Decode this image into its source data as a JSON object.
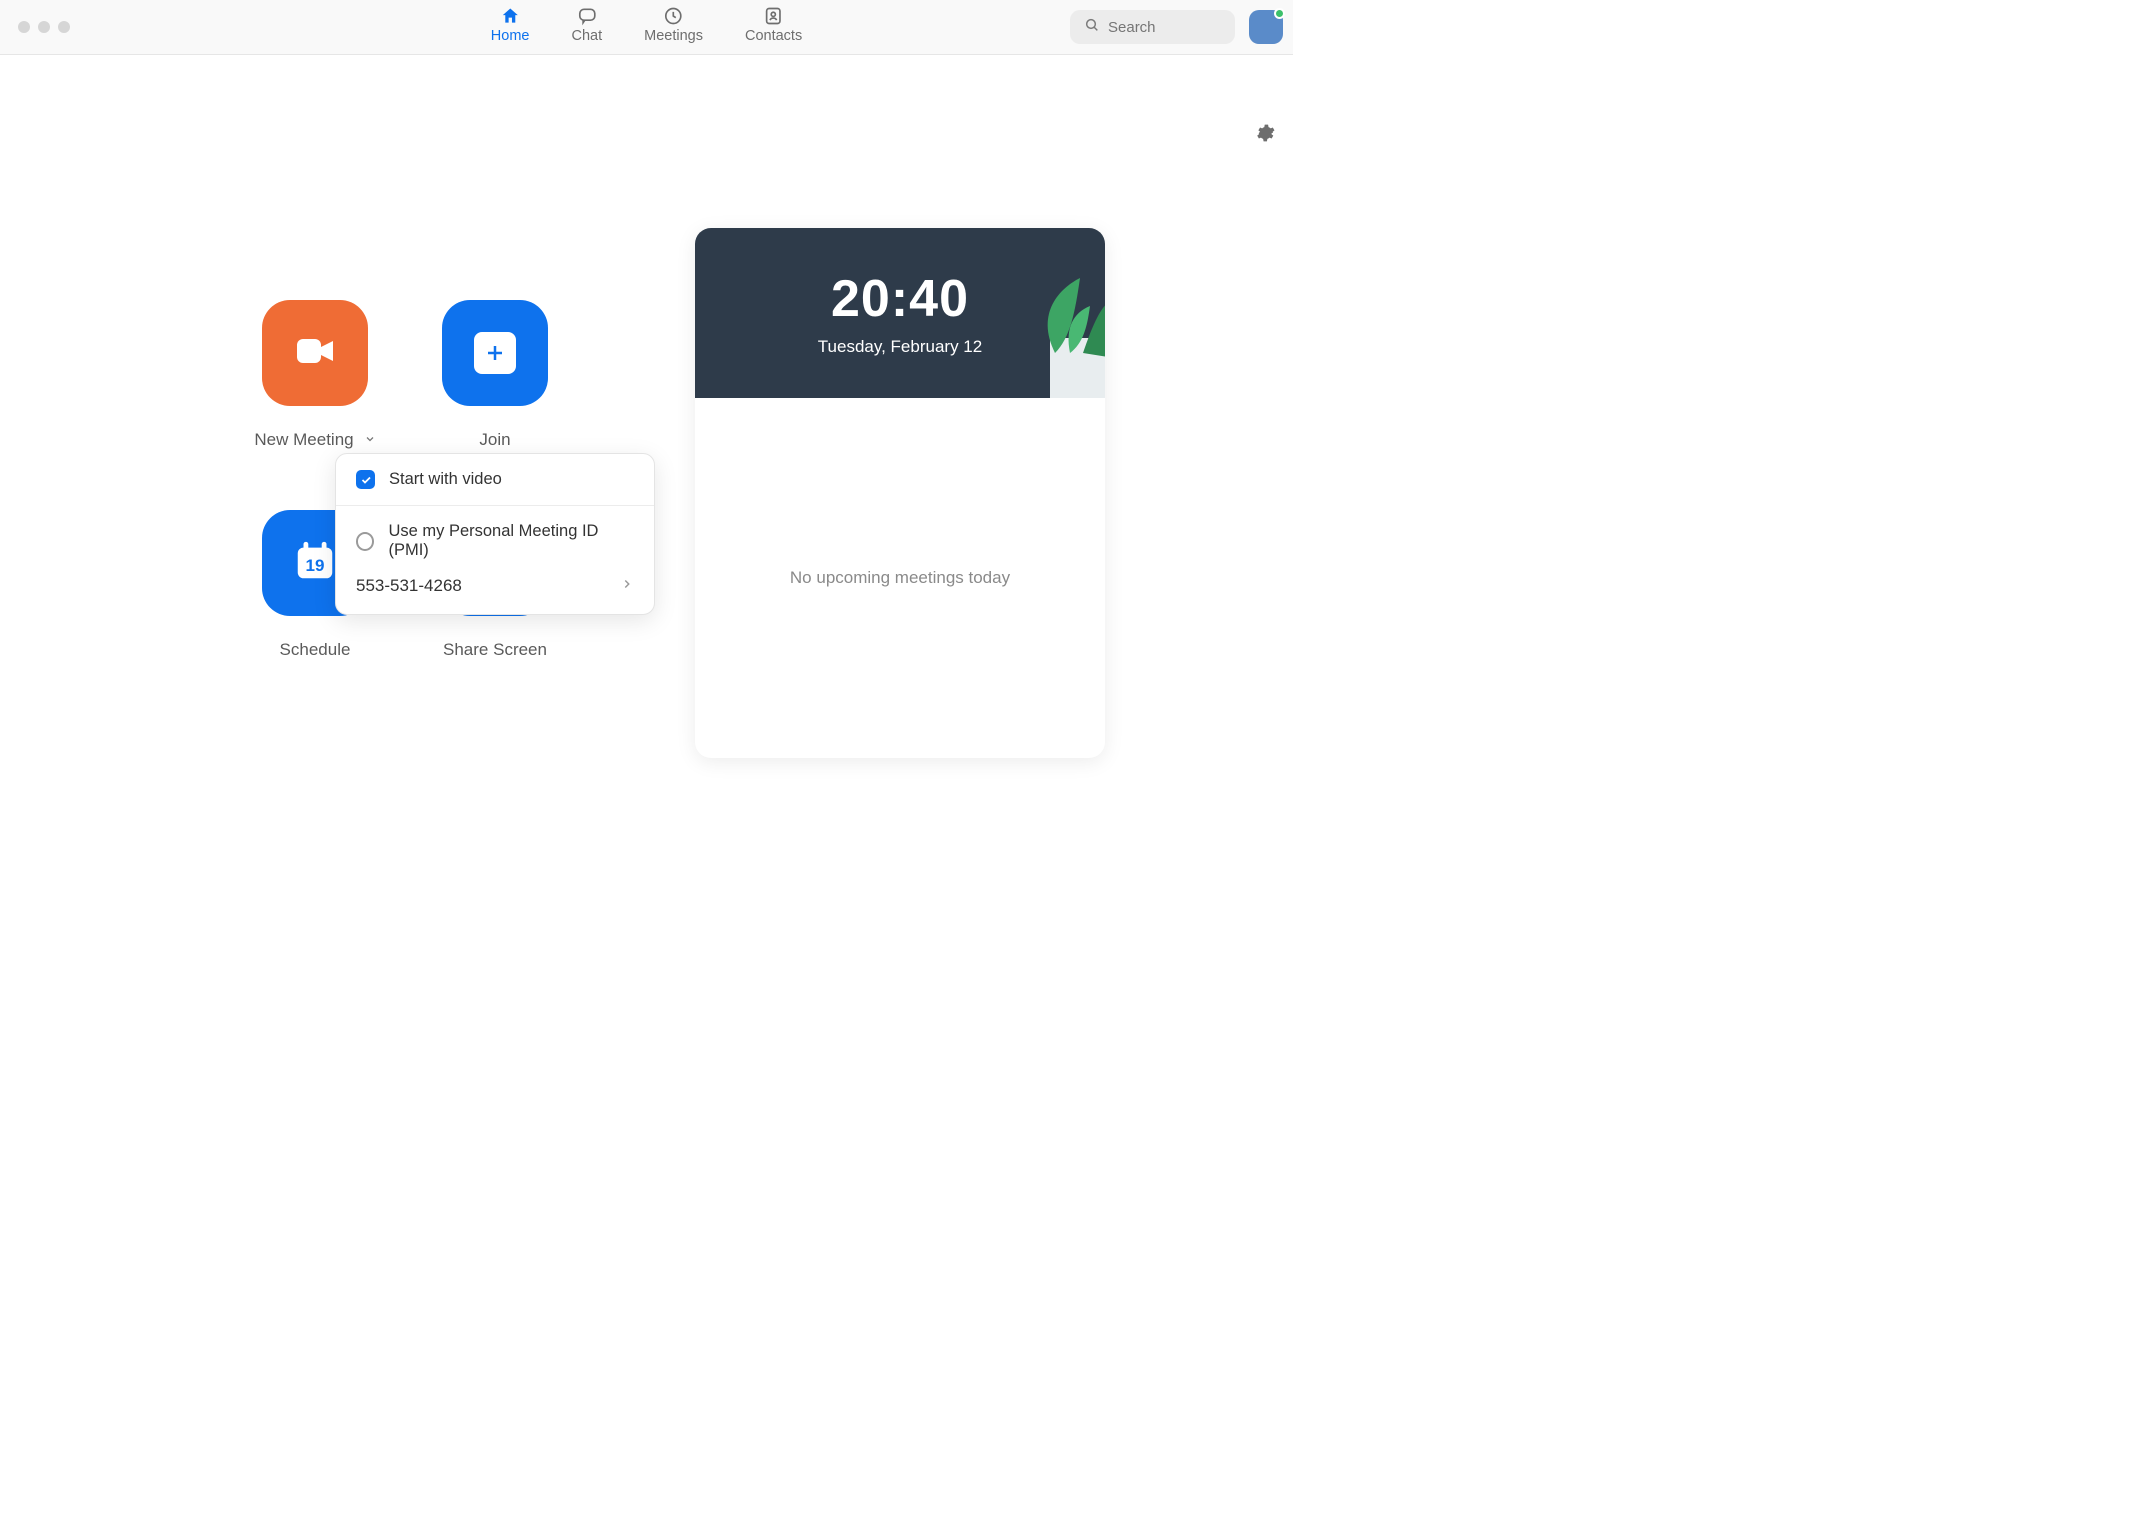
{
  "nav": {
    "tabs": [
      {
        "label": "Home"
      },
      {
        "label": "Chat"
      },
      {
        "label": "Meetings"
      },
      {
        "label": "Contacts"
      }
    ],
    "search_placeholder": "Search"
  },
  "tiles": {
    "new_meeting": "New Meeting",
    "join": "Join",
    "schedule": "Schedule",
    "schedule_day": "19",
    "share_screen": "Share Screen"
  },
  "dropdown": {
    "start_with_video": "Start with video",
    "use_pmi": "Use my Personal Meeting ID (PMI)",
    "pmi_number": "553-531-4268"
  },
  "calendar": {
    "time": "20:40",
    "date": "Tuesday, February 12",
    "empty": "No upcoming meetings today"
  },
  "colors": {
    "accent": "#0e72ed",
    "orange": "#ef6c35"
  }
}
